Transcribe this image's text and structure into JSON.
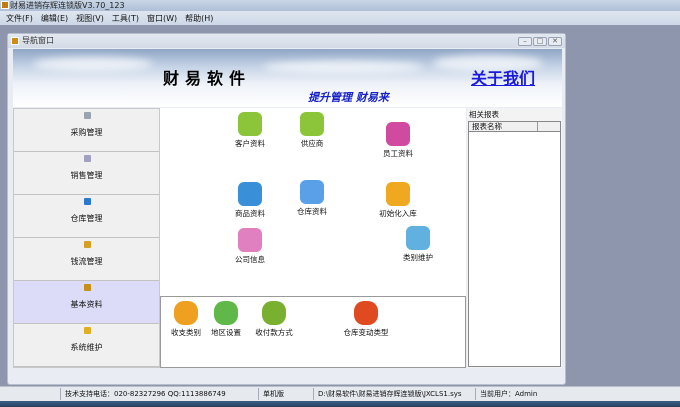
{
  "app": {
    "title": "财易进销存辉连锁版V3.70_123"
  },
  "menu": [
    "文件(F)",
    "编辑(E)",
    "视图(V)",
    "工具(T)",
    "窗口(W)",
    "帮助(H)"
  ],
  "child": {
    "title": "导航窗口",
    "min": "–",
    "max": "□",
    "close": "✕"
  },
  "banner": {
    "brand": "财易软件",
    "slogan": "提升管理 财易来",
    "about": "关于我们"
  },
  "nav": [
    {
      "label": "采购管理",
      "icon": "purchase-icon",
      "color": "#9aa4b0"
    },
    {
      "label": "销售管理",
      "icon": "sales-icon",
      "color": "#a0a0c0"
    },
    {
      "label": "仓库管理",
      "icon": "warehouse-icon",
      "color": "#2a78d0"
    },
    {
      "label": "钱流管理",
      "icon": "money-icon",
      "color": "#d8a020"
    },
    {
      "label": "基本资料",
      "icon": "basic-info-icon",
      "color": "#c89018",
      "active": true
    },
    {
      "label": "系统维护",
      "icon": "system-icon",
      "color": "#e0b020"
    }
  ],
  "tiles": [
    {
      "label": "客户资料",
      "icon": "customer-icon",
      "color": "#8cc43a"
    },
    {
      "label": "供应商",
      "icon": "supplier-icon",
      "color": "#8cc43a"
    },
    {
      "label": "员工资料",
      "icon": "employee-icon",
      "color": "#d04aa0"
    },
    {
      "label": "商品资料",
      "icon": "goods-icon",
      "color": "#3a90d8"
    },
    {
      "label": "仓库资料",
      "icon": "warehouse-data-icon",
      "color": "#5aa0e8"
    },
    {
      "label": "初始化入库",
      "icon": "init-stock-icon",
      "color": "#f0a820"
    },
    {
      "label": "公司信息",
      "icon": "company-icon",
      "color": "#e080c0"
    },
    {
      "label": "类别维护",
      "icon": "category-icon",
      "color": "#60b0e0"
    }
  ],
  "bottom_tiles": [
    {
      "label": "收支类别",
      "icon": "purse-icon",
      "color": "#f0a020"
    },
    {
      "label": "地区设置",
      "icon": "globe-icon",
      "color": "#60b848"
    },
    {
      "label": "收付款方式",
      "icon": "moneybag-icon",
      "color": "#7ab030"
    },
    {
      "label": "仓库变动类型",
      "icon": "change-type-icon",
      "color": "#e04a20"
    }
  ],
  "right": {
    "title": "相关报表",
    "col1": "报表名称",
    "col2": ""
  },
  "status": {
    "support": "技术支持电话：020-82327296 QQ:1113886749",
    "mode": "单机版",
    "path": "D:\\财易软件\\财易进销存辉连锁版\\JXCLS1.sys",
    "user": "当前用户：Admin"
  }
}
